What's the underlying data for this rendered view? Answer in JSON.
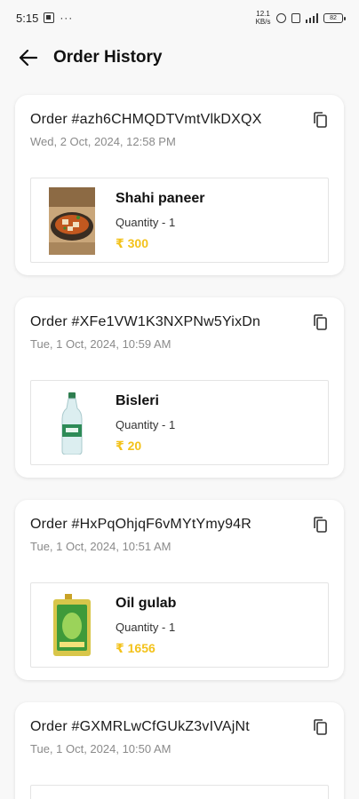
{
  "status_bar": {
    "time": "5:15",
    "dots": "···",
    "net_speed_top": "12.1",
    "net_speed_bottom": "KB/s",
    "battery": "82"
  },
  "header": {
    "title": "Order History"
  },
  "colors": {
    "price": "#f3c21b",
    "muted": "#8a8a8a",
    "background": "#f8f8f8"
  },
  "orders": [
    {
      "order_id": "Order #azh6CHMQDTVmtVlkDXQX",
      "date": "Wed, 2 Oct, 2024, 12:58 PM",
      "item_name": "Shahi paneer",
      "quantity": "Quantity - 1",
      "price": "₹ 300"
    },
    {
      "order_id": "Order #XFe1VW1K3NXPNw5YixDn",
      "date": "Tue, 1 Oct, 2024, 10:59 AM",
      "item_name": "Bisleri",
      "quantity": "Quantity - 1",
      "price": "₹ 20"
    },
    {
      "order_id": "Order #HxPqOhjqF6vMYtYmy94R",
      "date": "Tue, 1 Oct, 2024, 10:51 AM",
      "item_name": "Oil gulab",
      "quantity": "Quantity - 1",
      "price": "₹ 1656"
    },
    {
      "order_id": "Order #GXMRLwCfGUkZ3vIVAjNt",
      "date": "Tue, 1 Oct, 2024, 10:50 AM"
    }
  ]
}
